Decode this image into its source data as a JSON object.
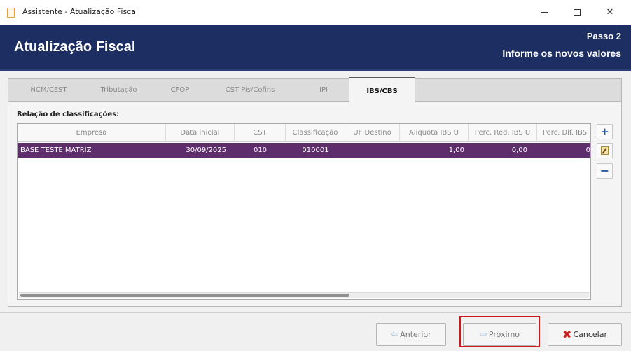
{
  "window": {
    "title": "Assistente - Atualização Fiscal"
  },
  "header": {
    "title": "Atualização Fiscal",
    "step": "Passo 2",
    "subtitle": "Informe os novos valores"
  },
  "tabs": [
    {
      "label": "NCM/CEST",
      "active": false
    },
    {
      "label": "Tributação",
      "active": false
    },
    {
      "label": "CFOP",
      "active": false
    },
    {
      "label": "CST Pis/Cofins",
      "active": false
    },
    {
      "label": "IPI",
      "active": false
    },
    {
      "label": "IBS/CBS",
      "active": true
    }
  ],
  "section_label": "Relação de classificações:",
  "grid": {
    "columns": [
      "Empresa",
      "Data inicial",
      "CST",
      "Classificação",
      "UF Destino",
      "Aliquota IBS U",
      "Perc. Red. IBS U",
      "Perc. Dif. IBS"
    ],
    "rows": [
      {
        "empresa": "BASE TESTE MATRIZ",
        "data_inicial": "30/09/2025",
        "cst": "010",
        "classificacao": "010001",
        "uf_destino": "",
        "aliquota_ibs": "1,00",
        "perc_red_ibs": "0,00",
        "perc_dif_ibs": "0"
      }
    ],
    "selected_row_color": "#5e2e6c"
  },
  "side_buttons": {
    "add": "+",
    "remove": "−"
  },
  "footer": {
    "prev_label": "Anterior",
    "next_label": "Próximo",
    "cancel_label": "Cancelar"
  },
  "colors": {
    "header_band": "#1c2e62",
    "highlight": "#d0151b"
  }
}
